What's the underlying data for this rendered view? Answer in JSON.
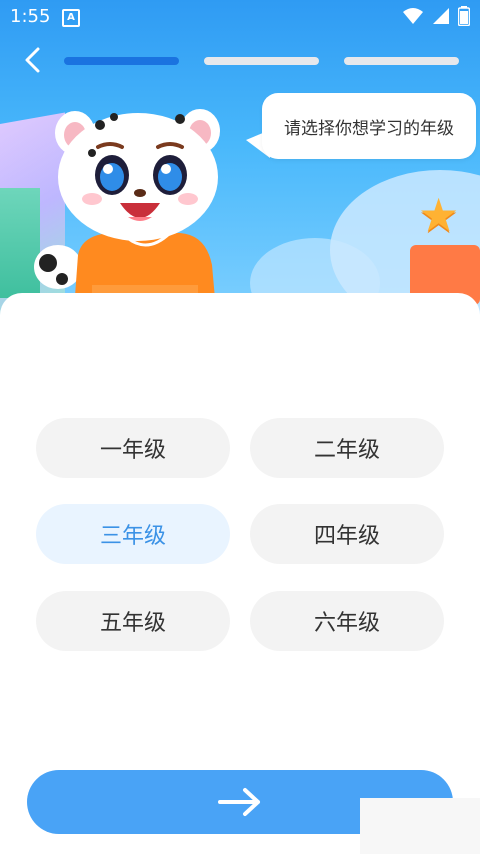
{
  "status_bar": {
    "time": "1:55",
    "notification_icon": "a-icon",
    "icons": [
      "wifi-icon",
      "signal-icon",
      "battery-icon"
    ]
  },
  "header": {
    "back_icon": "chevron-left-icon",
    "progress_steps": 3,
    "progress_current": 1,
    "colors": {
      "active": "#1a73e0",
      "inactive": "#e6e8ec"
    }
  },
  "bubble": {
    "text": "请选择你想学习的年级"
  },
  "grades": {
    "items": [
      {
        "label": "一年级",
        "selected": false
      },
      {
        "label": "二年级",
        "selected": false
      },
      {
        "label": "三年级",
        "selected": true
      },
      {
        "label": "四年级",
        "selected": false
      },
      {
        "label": "五年级",
        "selected": false
      },
      {
        "label": "六年级",
        "selected": false
      }
    ]
  },
  "next_button": {
    "icon": "arrow-right-icon",
    "color": "#49a3f6"
  },
  "colors": {
    "accent": "#3b92e6",
    "selected_bg": "#e9f4ff",
    "unselected_bg": "#f3f3f3"
  }
}
